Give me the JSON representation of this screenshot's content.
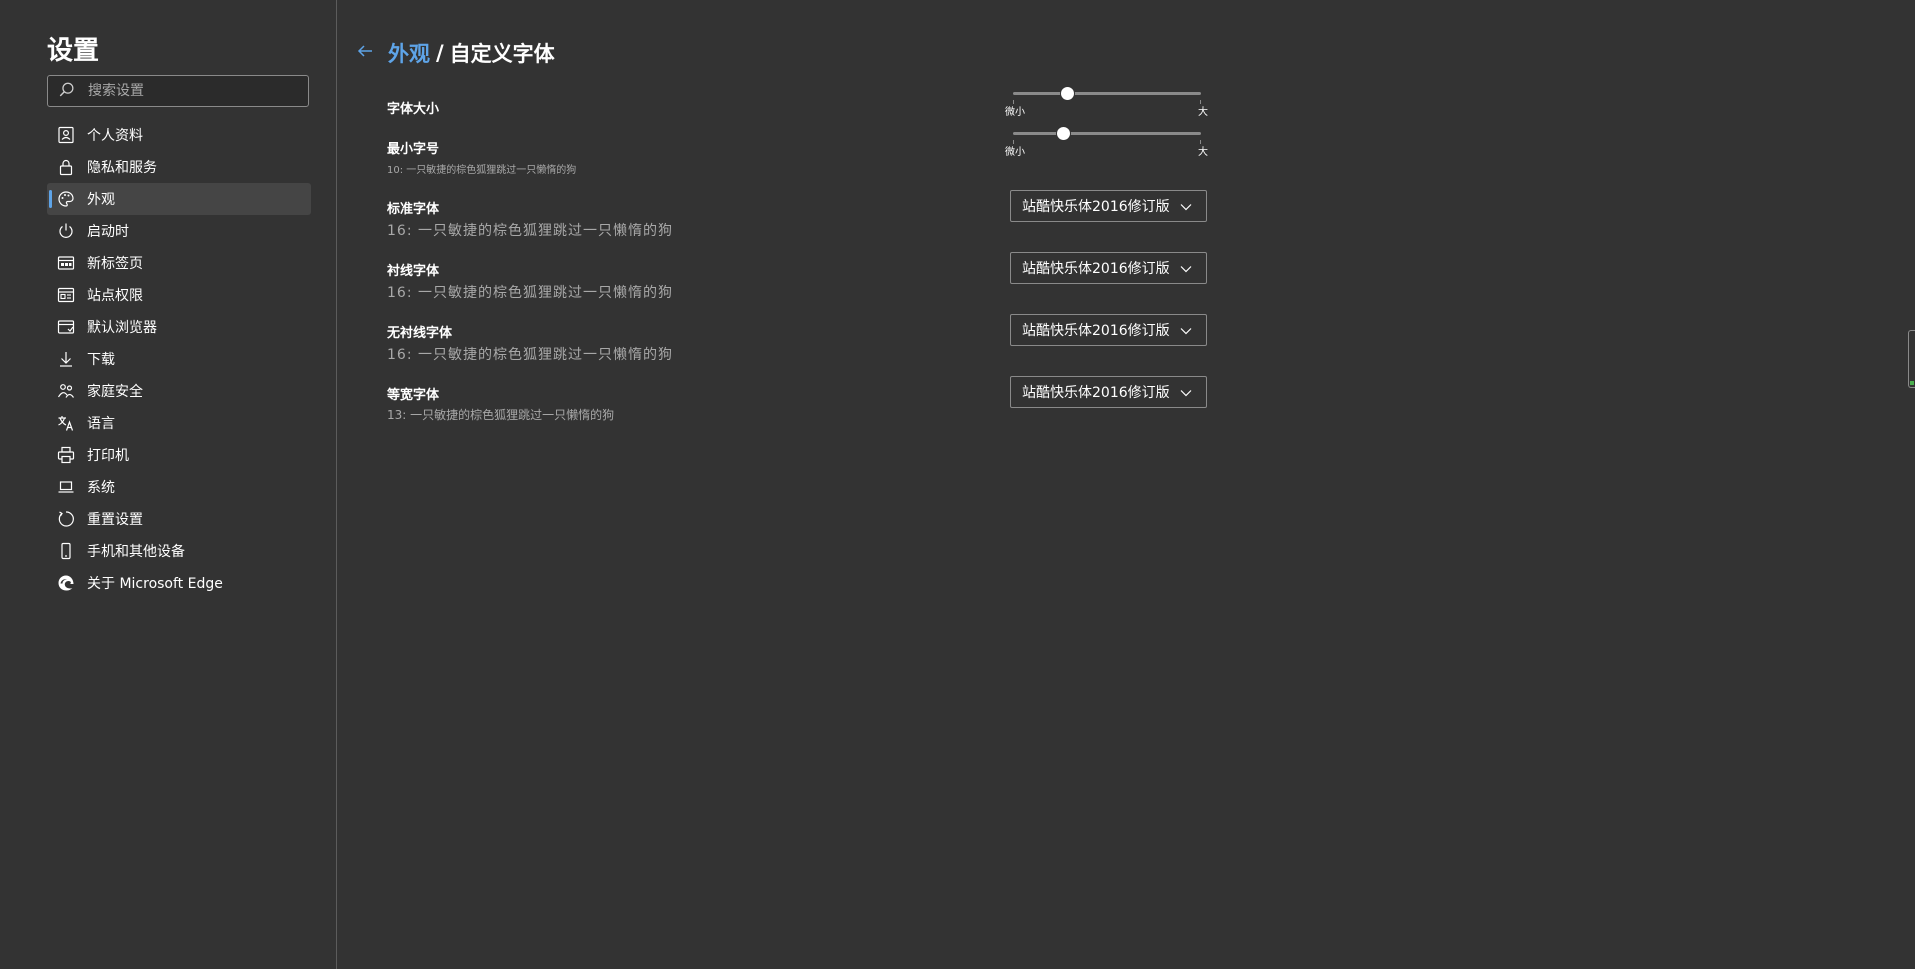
{
  "sidebar": {
    "title": "设置",
    "search_placeholder": "搜索设置",
    "items": [
      {
        "label": "个人资料",
        "icon": "profile-icon"
      },
      {
        "label": "隐私和服务",
        "icon": "lock-icon"
      },
      {
        "label": "外观",
        "icon": "palette-icon",
        "active": true
      },
      {
        "label": "启动时",
        "icon": "power-icon"
      },
      {
        "label": "新标签页",
        "icon": "new-tab-icon"
      },
      {
        "label": "站点权限",
        "icon": "site-permissions-icon"
      },
      {
        "label": "默认浏览器",
        "icon": "default-browser-icon"
      },
      {
        "label": "下载",
        "icon": "download-icon"
      },
      {
        "label": "家庭安全",
        "icon": "family-icon"
      },
      {
        "label": "语言",
        "icon": "language-icon"
      },
      {
        "label": "打印机",
        "icon": "printer-icon"
      },
      {
        "label": "系统",
        "icon": "laptop-icon"
      },
      {
        "label": "重置设置",
        "icon": "reset-icon"
      },
      {
        "label": "手机和其他设备",
        "icon": "phone-icon"
      },
      {
        "label": "关于 Microsoft Edge",
        "icon": "edge-logo-icon"
      }
    ]
  },
  "header": {
    "parent_link": "外观",
    "separator": "/",
    "current": "自定义字体"
  },
  "font_size": {
    "label": "字体大小",
    "min_label": "微小",
    "max_label": "大",
    "value_fraction": 0.29
  },
  "min_font_size": {
    "label": "最小字号",
    "sample": "10: 一只敏捷的棕色狐狸跳过一只懒惰的狗",
    "min_label": "微小",
    "max_label": "大",
    "value_fraction": 0.27
  },
  "standard_font": {
    "label": "标准字体",
    "sample": "16: 一只敏捷的棕色狐狸跳过一只懒惰的狗",
    "value": "站酷快乐体2016修订版"
  },
  "serif_font": {
    "label": "衬线字体",
    "sample": "16: 一只敏捷的棕色狐狸跳过一只懒惰的狗",
    "value": "站酷快乐体2016修订版"
  },
  "sans_serif_font": {
    "label": "无衬线字体",
    "sample": "16: 一只敏捷的棕色狐狸跳过一只懒惰的狗",
    "value": "站酷快乐体2016修订版"
  },
  "fixed_width_font": {
    "label": "等宽字体",
    "sample": "13: 一只敏捷的棕色狐狸跳过一只懒惰的狗",
    "value": "站酷快乐体2016修订版"
  },
  "colors": {
    "background": "#333333",
    "accent": "#5ea4e8",
    "muted_text": "#a8a8a8"
  }
}
